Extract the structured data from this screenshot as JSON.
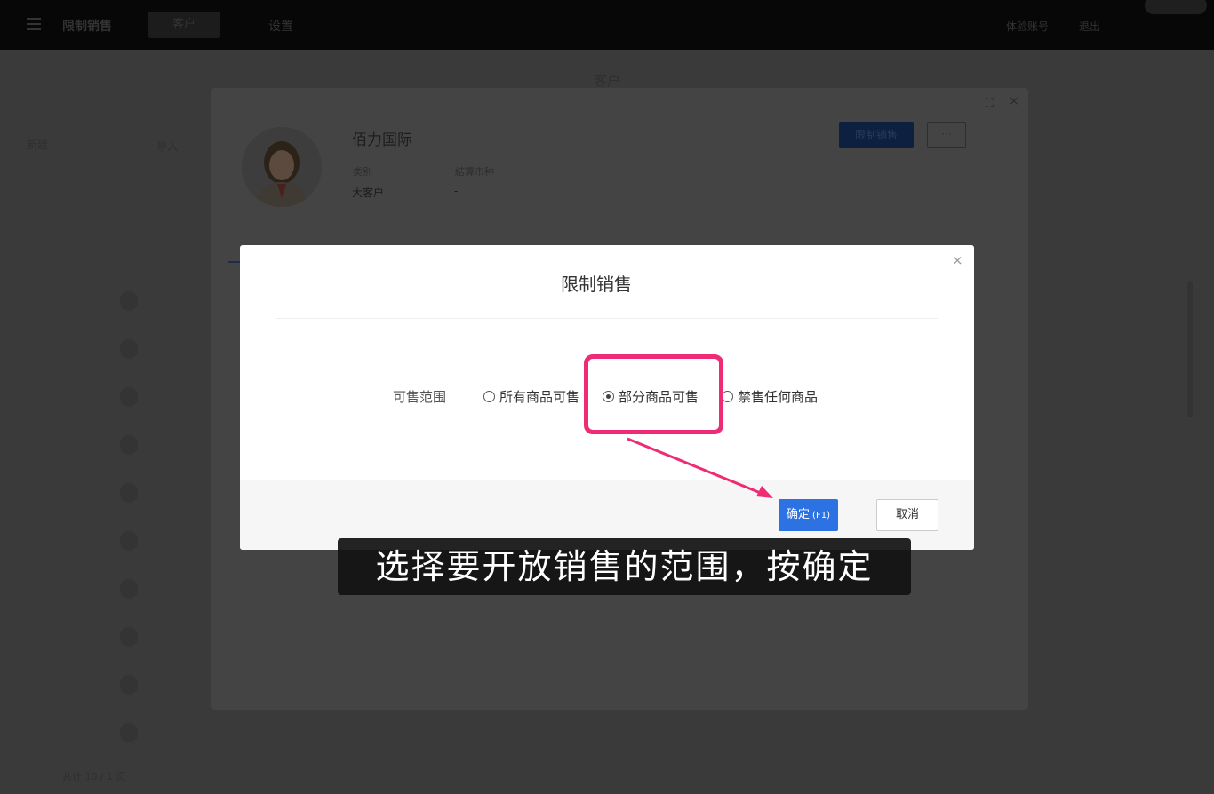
{
  "topbar": {
    "app_name": "限制销售",
    "nav_active": "客户",
    "nav_item": "设置",
    "right_a": "体验账号",
    "right_b": "退出"
  },
  "background": {
    "page_title": "客户",
    "left_a": "新建",
    "left_b": "导入",
    "footer": "共计 10 / 1 页"
  },
  "customer": {
    "name": "佰力国际",
    "category_label": "类别",
    "currency_label": "結算市种",
    "category_value": "大客户",
    "currency_value": "-",
    "primary_action": "限制销售",
    "more_label": "···"
  },
  "modal": {
    "title": "限制销售",
    "close": "×",
    "range_label": "可售范围",
    "options": [
      {
        "label": "所有商品可售",
        "checked": false
      },
      {
        "label": "部分商品可售",
        "checked": true
      },
      {
        "label": "禁售任何商品",
        "checked": false
      }
    ],
    "ok_label": "确定",
    "ok_shortcut": "(F1)",
    "cancel_label": "取消"
  },
  "annotation": {
    "caption": "选择要开放销售的范围，按确定",
    "highlight_color": "#ee2b74"
  }
}
